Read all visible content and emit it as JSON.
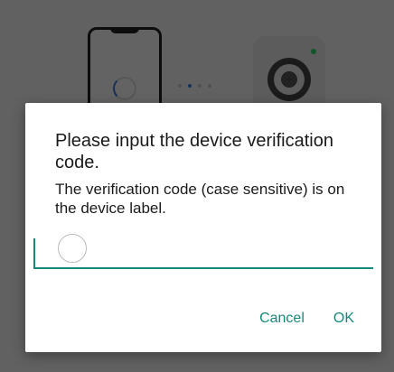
{
  "dialog": {
    "title": "Please input the device verification code.",
    "message": "The verification code (case sensitive) is on the device label.",
    "input": {
      "value": "",
      "placeholder": ""
    },
    "cancel_label": "Cancel",
    "ok_label": "OK"
  },
  "colors": {
    "accent": "#168a7a",
    "scrim": "#000000",
    "dialog_background": "#ffffff",
    "camera_led": "#2bd46a",
    "spinner": "#3a7bd5"
  },
  "icons": {
    "phone": "phone-icon",
    "camera": "camera-icon",
    "progress_dots": "progress-dots-icon",
    "input_indicator": "circle-icon"
  }
}
